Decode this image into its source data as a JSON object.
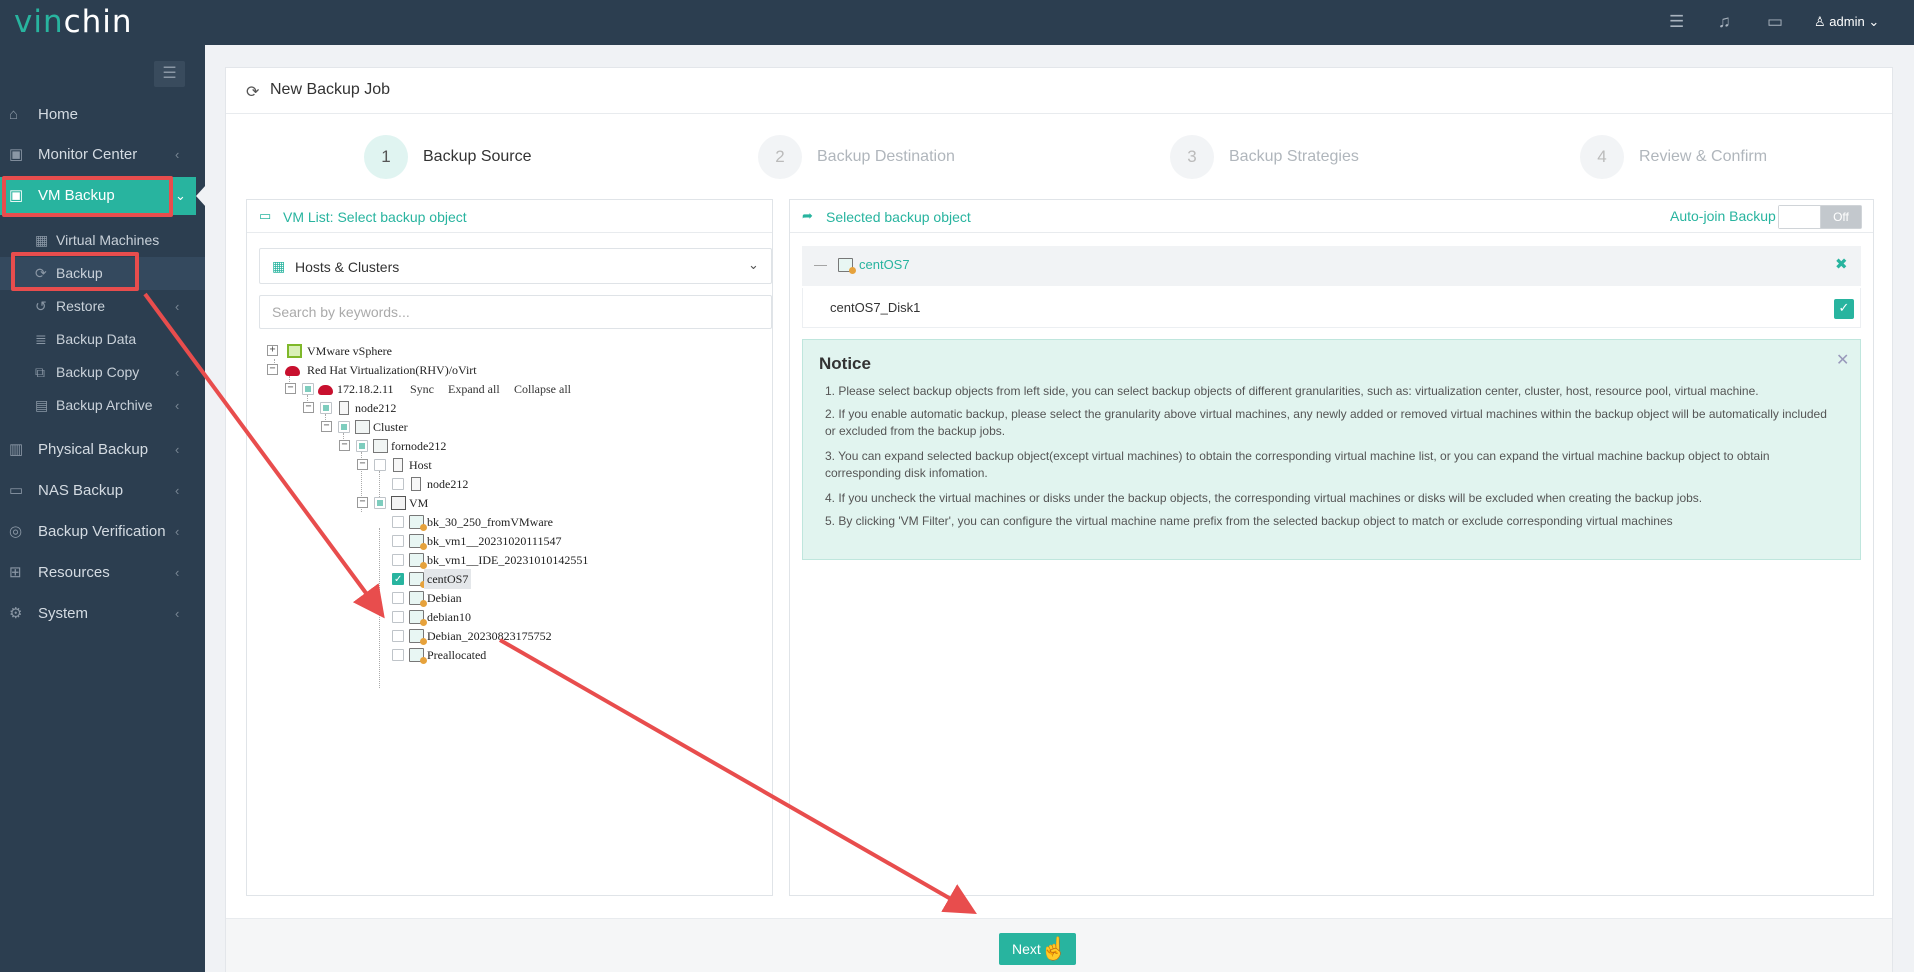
{
  "app": {
    "logo_text_green": "vin",
    "logo_text_white": "chin",
    "user": "admin"
  },
  "sidebar": {
    "items": [
      {
        "label": "Home",
        "icon": "home-icon"
      },
      {
        "label": "Monitor Center",
        "icon": "monitor-icon"
      },
      {
        "label": "VM Backup",
        "icon": "vm-icon"
      },
      {
        "label": "Physical Backup",
        "icon": "server-icon"
      },
      {
        "label": "NAS Backup",
        "icon": "nas-icon"
      },
      {
        "label": "Backup Verification",
        "icon": "verification-icon"
      },
      {
        "label": "Resources",
        "icon": "resources-icon"
      },
      {
        "label": "System",
        "icon": "gear-icon"
      }
    ],
    "subitems": [
      {
        "label": "Virtual Machines"
      },
      {
        "label": "Backup"
      },
      {
        "label": "Restore"
      },
      {
        "label": "Backup Data"
      },
      {
        "label": "Backup Copy"
      },
      {
        "label": "Backup Archive"
      }
    ]
  },
  "page": {
    "title": "New Backup Job"
  },
  "steps": [
    {
      "num": "1",
      "label": "Backup Source"
    },
    {
      "num": "2",
      "label": "Backup Destination"
    },
    {
      "num": "3",
      "label": "Backup Strategies"
    },
    {
      "num": "4",
      "label": "Review & Confirm"
    }
  ],
  "left_panel": {
    "title": "VM List: Select backup object",
    "dropdown": "Hosts & Clusters",
    "search_placeholder": "Search by keywords...",
    "tree": {
      "vsphere": "VMware vSphere",
      "rhv": "Red Hat Virtualization(RHV)/oVirt",
      "ip": "172.18.2.11",
      "sync": "Sync",
      "expand": "Expand all",
      "collapse": "Collapse all",
      "node": "node212",
      "cluster": "Cluster",
      "fornode": "fornode212",
      "host": "Host",
      "hostnode": "node212",
      "vm": "VM",
      "vms": [
        "bk_30_250_fromVMware",
        "bk_vm1__20231020111547",
        "bk_vm1__IDE_20231010142551",
        "centOS7",
        "Debian",
        "debian10",
        "Debian_20230823175752",
        "Preallocated"
      ]
    }
  },
  "right_panel": {
    "title": "Selected backup object",
    "auto_join": "Auto-join Backup",
    "toggle": "Off",
    "group": "centOS7",
    "disk": "centOS7_Disk1",
    "notice": {
      "title": "Notice",
      "items": [
        "1. Please select backup objects from left side, you can select backup objects of different granularities, such as: virtualization center, cluster, host, resource pool, virtual machine.",
        "2. If you enable automatic backup, please select the granularity above virtual machines, any newly added or removed virtual machines within the backup object will be automatically included or excluded from the backup jobs.",
        "3. You can expand selected backup object(except virtual machines) to obtain the corresponding virtual machine list, or you can expand the virtual machine backup object to obtain corresponding disk infomation.",
        "4. If you uncheck the virtual machines or disks under the backup objects, the corresponding virtual machines or disks will be excluded when creating the backup jobs.",
        "5. By clicking 'VM Filter', you can configure the virtual machine name prefix from the selected backup object to match or exclude corresponding virtual machines"
      ]
    }
  },
  "footer": {
    "next": "Next"
  },
  "colors": {
    "accent": "#28b49f",
    "sidebar": "#2c3e50",
    "highlight": "#e84d4d"
  }
}
